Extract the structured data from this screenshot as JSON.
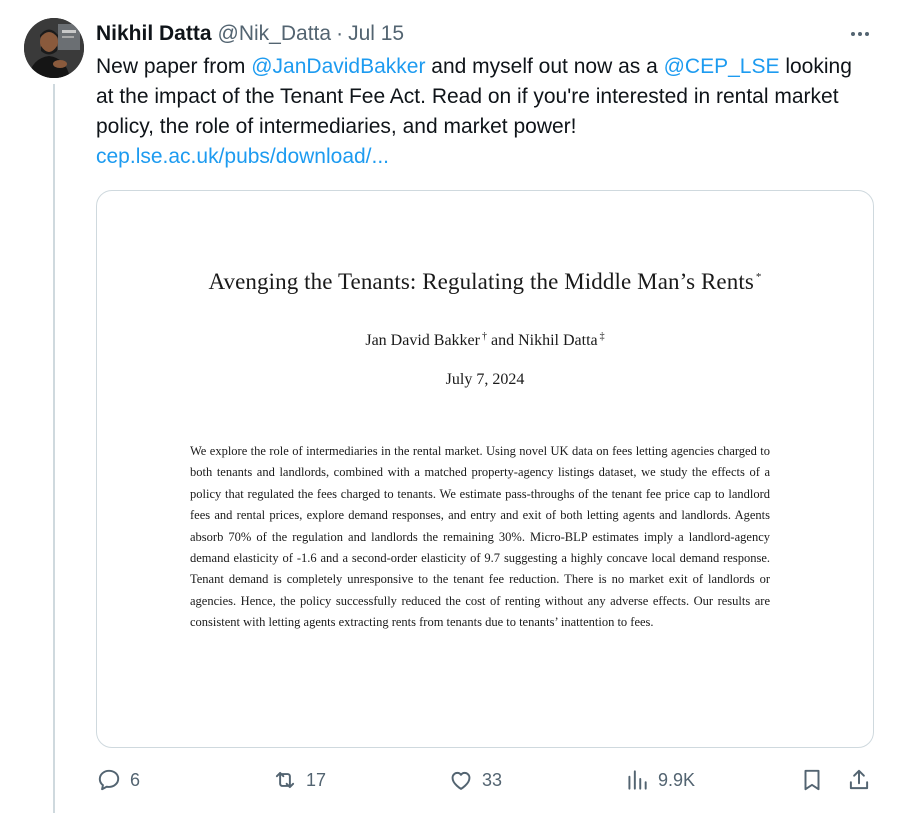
{
  "tweet": {
    "author_name": "Nikhil Datta",
    "handle": "@Nik_Datta",
    "separator": "·",
    "date": "Jul 15",
    "text_1": "New paper from ",
    "mention_1": "@JanDavidBakker",
    "text_2": " and myself out now as a ",
    "mention_2": "@CEP_LSE",
    "text_3": " looking at the impact of the Tenant Fee Act. Read on if you're interested in rental market policy, the role of intermediaries, and market power!",
    "link": "cep.lse.ac.uk/pubs/download/..."
  },
  "paper": {
    "title": "Avenging the Tenants: Regulating the Middle Man’s Rents",
    "title_mark": "*",
    "author_1": "Jan David Bakker",
    "author_1_mark": "†",
    "and": " and ",
    "author_2": "Nikhil Datta",
    "author_2_mark": "‡",
    "date": "July 7, 2024",
    "abstract": "We explore the role of intermediaries in the rental market. Using novel UK data on fees letting agencies charged to both tenants and landlords, combined with a matched property-agency listings dataset, we study the effects of a policy that regulated the fees charged to tenants. We estimate pass-throughs of the tenant fee price cap to landlord fees and rental prices, explore demand responses, and entry and exit of both letting agents and landlords. Agents absorb 70% of the regulation and landlords the remaining 30%. Micro-BLP estimates imply a landlord-agency demand elasticity of -1.6 and a second-order elasticity of 9.7 suggesting a highly concave local demand response. Tenant demand is completely unresponsive to the tenant fee reduction. There is no market exit of landlords or agencies. Hence, the policy successfully reduced the cost of renting without any adverse effects. Our results are consistent with letting agents extracting rents from tenants due to tenants’ inattention to fees."
  },
  "actions": {
    "replies": "6",
    "reposts": "17",
    "likes": "33",
    "views": "9.9K"
  },
  "icons": {
    "more": "more-horizontal-icon",
    "reply": "reply-icon",
    "repost": "repost-icon",
    "like": "heart-icon",
    "views": "views-chart-icon",
    "bookmark": "bookmark-icon",
    "share": "share-icon"
  },
  "colors": {
    "link": "#1d9bf0",
    "text": "#0f1419",
    "secondary": "#536471",
    "border": "#cfd9de"
  }
}
